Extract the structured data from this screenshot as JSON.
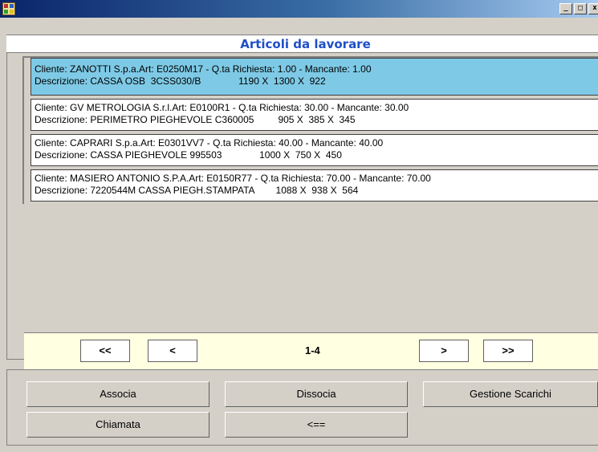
{
  "window": {
    "minimize": "_",
    "maximize": "□",
    "close": "x"
  },
  "header": {
    "title": "Articoli da lavorare"
  },
  "items": [
    {
      "line1": "Cliente: ZANOTTI S.p.a.Art: E0250M17 - Q.ta Richiesta: 1.00 - Mancante: 1.00",
      "line2": "Descrizione: CASSA OSB  3CSS030/B              1190 X  1300 X  922",
      "selected": true
    },
    {
      "line1": "Cliente: GV METROLOGIA S.r.l.Art: E0100R1 - Q.ta Richiesta: 30.00 - Mancante: 30.00",
      "line2": "Descrizione: PERIMETRO PIEGHEVOLE C360005         905 X  385 X  345",
      "selected": false
    },
    {
      "line1": "Cliente: CAPRARI S.p.a.Art: E0301VV7 - Q.ta Richiesta: 40.00 - Mancante: 40.00",
      "line2": "Descrizione: CASSA PIEGHEVOLE 995503              1000 X  750 X  450",
      "selected": false
    },
    {
      "line1": "Cliente: MASIERO ANTONIO S.P.A.Art: E0150R77 - Q.ta Richiesta: 70.00 - Mancante: 70.00",
      "line2": "Descrizione: 7220544M CASSA PIEGH.STAMPATA        1088 X  938 X  564",
      "selected": false
    }
  ],
  "pager": {
    "first": "<<",
    "prev": "<",
    "info": "1-4",
    "next": ">",
    "last": ">>"
  },
  "buttons": {
    "associa": "Associa",
    "dissocia": "Dissocia",
    "gestione_scarichi": "Gestione Scarichi",
    "chiamata": "Chiamata",
    "back": "<=="
  },
  "colors": {
    "accent_title": "#1f4fc7",
    "selected_row": "#7ecae6",
    "pager_bg": "#ffffe1"
  }
}
